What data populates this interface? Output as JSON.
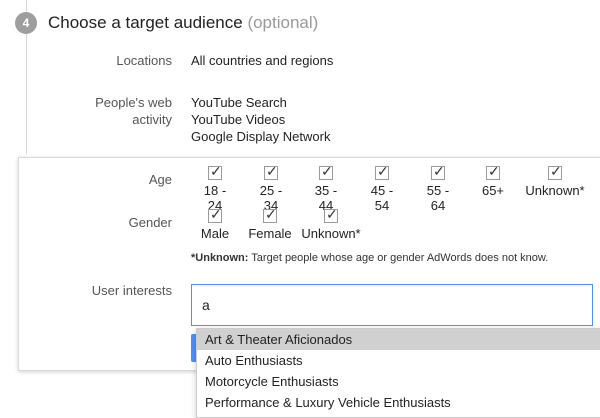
{
  "step": {
    "number": "4",
    "title": "Choose a target audience",
    "optional_label": "(optional)"
  },
  "locations": {
    "label": "Locations",
    "value": "All countries and regions"
  },
  "web_activity": {
    "label_line1": "People's web",
    "label_line2": "activity",
    "items": [
      "YouTube Search",
      "YouTube Videos",
      "Google Display Network"
    ]
  },
  "age": {
    "label": "Age",
    "options": [
      {
        "label": "18 - 24",
        "checked": true
      },
      {
        "label": "25 - 34",
        "checked": true
      },
      {
        "label": "35 - 44",
        "checked": true
      },
      {
        "label": "45 - 54",
        "checked": true
      },
      {
        "label": "55 - 64",
        "checked": true
      },
      {
        "label": "65+",
        "checked": true
      },
      {
        "label": "Unknown*",
        "checked": true
      }
    ]
  },
  "gender": {
    "label": "Gender",
    "options": [
      {
        "label": "Male",
        "checked": true
      },
      {
        "label": "Female",
        "checked": true
      },
      {
        "label": "Unknown*",
        "checked": true
      }
    ]
  },
  "note": {
    "bold": "*Unknown:",
    "text": " Target people whose age or gender AdWords does not know."
  },
  "user_interests": {
    "label": "User interests",
    "input_value": "a",
    "suggestions": [
      "Art & Theater Aficionados",
      "Auto Enthusiasts",
      "Motorcycle Enthusiasts",
      "Performance & Luxury Vehicle Enthusiasts"
    ],
    "highlighted_index": 0
  },
  "check_glyph": "✓",
  "colors": {
    "accent": "#4d90fe",
    "step_circle": "#9e9e9e",
    "highlight": "#d0d0d0"
  }
}
